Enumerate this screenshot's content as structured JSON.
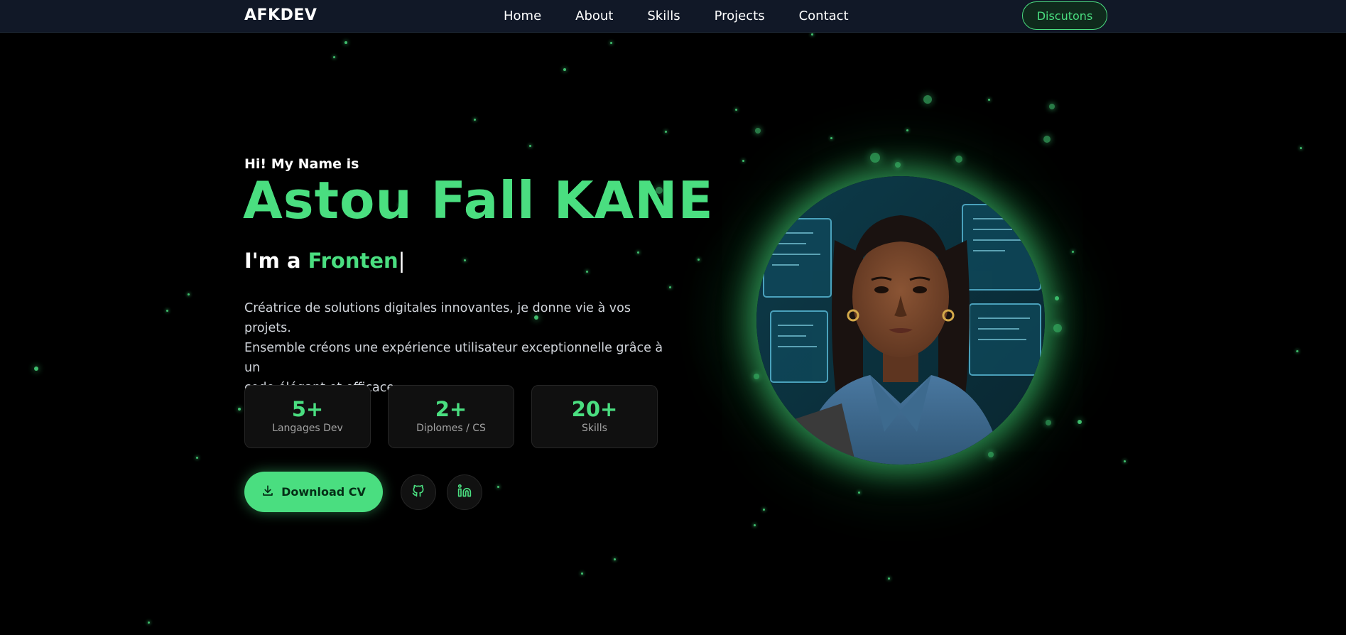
{
  "nav": {
    "brand": "AFKDEV",
    "links": [
      {
        "label": "Home"
      },
      {
        "label": "About"
      },
      {
        "label": "Skills"
      },
      {
        "label": "Projects"
      },
      {
        "label": "Contact"
      }
    ],
    "cta_label": "Discutons"
  },
  "hero": {
    "greeting": "Hi! My Name is",
    "name": "Astou Fall KANE",
    "role_prefix": "I'm a ",
    "role_typed": "Fronten",
    "role_cursor": "|",
    "description": [
      "Créatrice de solutions digitales innovantes, je donne vie à vos projets.",
      "Ensemble créons une expérience utilisateur exceptionnelle grâce à un",
      "code élégant et efficace."
    ],
    "stats": [
      {
        "value": "5+",
        "label": "Langages Dev"
      },
      {
        "value": "2+",
        "label": "Diplomes / CS"
      },
      {
        "value": "20+",
        "label": "Skills"
      }
    ],
    "download_label": "Download CV",
    "socials": [
      {
        "icon": "github-icon"
      },
      {
        "icon": "linkedin-icon"
      }
    ]
  },
  "colors": {
    "accent": "#4ade80",
    "background": "#000000",
    "navbar": "#111827"
  }
}
